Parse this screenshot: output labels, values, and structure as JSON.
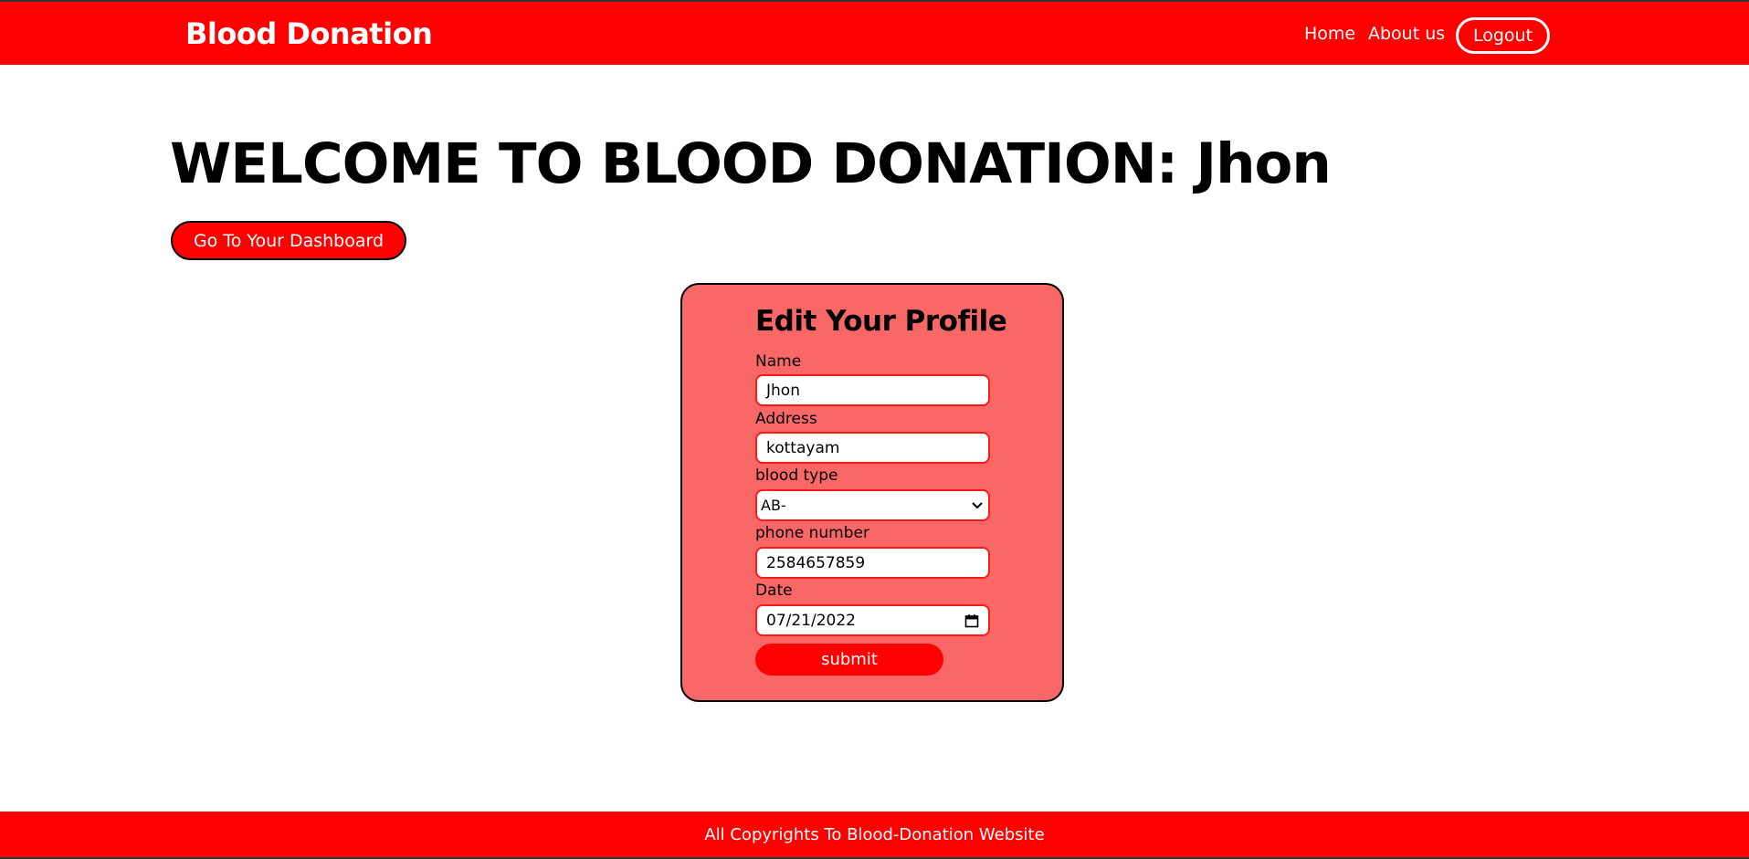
{
  "navbar": {
    "brand": "Blood Donation",
    "links": {
      "home": "Home",
      "about": "About us"
    },
    "logout_label": "Logout",
    "color": "#ff0000"
  },
  "welcome": {
    "heading": "WELCOME TO BLOOD DONATION: Jhon",
    "dashboard_button": "Go To Your Dashboard"
  },
  "form": {
    "title": "Edit Your Profile",
    "card_color": "#f96767",
    "fields": {
      "name": {
        "label": "Name",
        "value": "Jhon"
      },
      "address": {
        "label": "Address",
        "value": "kottayam"
      },
      "blood_type": {
        "label": "blood type",
        "value": "AB-"
      },
      "phone": {
        "label": "phone number",
        "value": "2584657859"
      },
      "date": {
        "label": "Date",
        "value": "07/21/2022"
      }
    },
    "submit_label": "submit"
  },
  "footer": {
    "text": "All Copyrights To Blood-Donation Website"
  }
}
